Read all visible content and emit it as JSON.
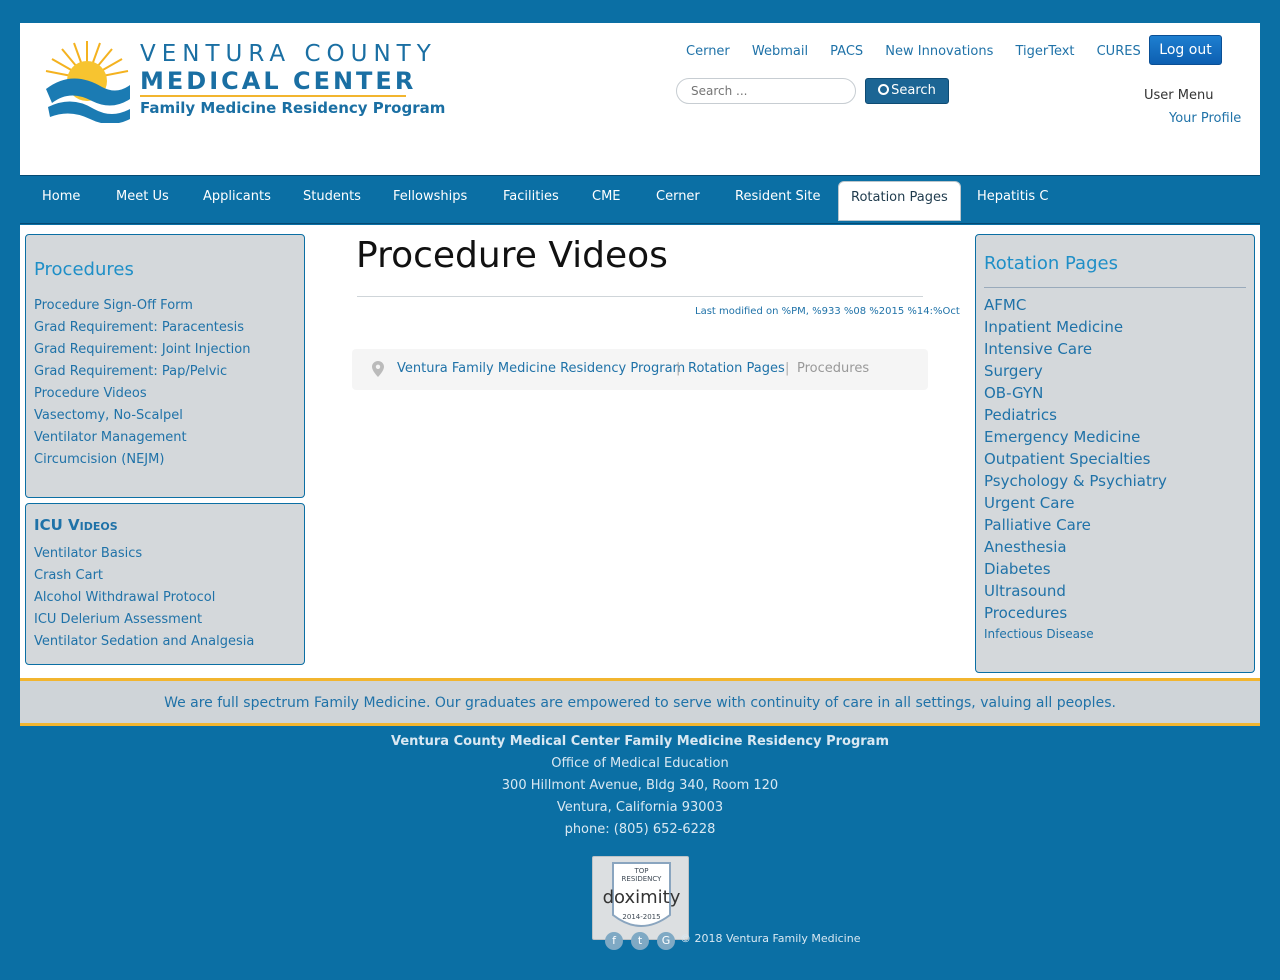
{
  "logo": {
    "line1": "VENTURA COUNTY",
    "line2": "MEDICAL CENTER",
    "line3": "Family Medicine Residency Program"
  },
  "top_links": [
    "Cerner",
    "Webmail",
    "PACS",
    "New Innovations",
    "TigerText",
    "CURES"
  ],
  "logout_label": "Log out",
  "search": {
    "placeholder": "Search ...",
    "button_label": "Search"
  },
  "user_menu": {
    "title": "User Menu",
    "profile_link": "Your Profile"
  },
  "nav": {
    "items": [
      "Home",
      "Meet Us",
      "Applicants",
      "Students",
      "Fellowships",
      "Facilities",
      "CME",
      "Cerner",
      "Resident Site",
      "Rotation Pages",
      "Hepatitis C"
    ],
    "active": "Rotation Pages"
  },
  "left_panel_procedures": {
    "title": "Procedures",
    "links": [
      "Procedure Sign-Off Form",
      "Grad Requirement: Paracentesis",
      "Grad Requirement: Joint Injection",
      "Grad Requirement: Pap/Pelvic",
      "Procedure Videos",
      "Vasectomy, No-Scalpel",
      "Ventilator Management",
      "Circumcision (NEJM)"
    ]
  },
  "left_panel_icu": {
    "title": "ICU Videos",
    "links": [
      "Ventilator Basics",
      "Crash Cart",
      "Alcohol Withdrawal Protocol",
      "ICU Delerium Assessment",
      "Ventilator Sedation and Analgesia"
    ]
  },
  "main": {
    "title": "Procedure Videos",
    "last_modified": "Last modified on %PM, %933 %08 %2015 %14:%Oct",
    "breadcrumb": [
      "Ventura Family Medicine Residency Program",
      "Rotation Pages",
      "Procedures"
    ]
  },
  "right_panel": {
    "title": "Rotation Pages",
    "links": [
      "AFMC",
      "Inpatient Medicine",
      "Intensive Care",
      "Surgery",
      "OB-GYN",
      "Pediatrics",
      "Emergency Medicine",
      "Outpatient Specialties",
      "Psychology & Psychiatry",
      "Urgent Care",
      "Palliative Care",
      "Anesthesia",
      "Diabetes",
      "Ultrasound",
      "Procedures",
      "Infectious Disease"
    ]
  },
  "tagline": "We are full spectrum Family Medicine. Our graduates are empowered to serve with continuity of care in all settings, valuing all peoples.",
  "footer": {
    "org": "Ventura County Medical Center Family Medicine Residency Program",
    "office": "Office of Medical Education",
    "address1": "300 Hillmont Avenue, Bldg 340, Room 120",
    "address2": "Ventura, California 93003",
    "phone": "phone: (805) 652-6228",
    "badge": {
      "top": "TOP",
      "mid": "RESIDENCY",
      "brand": "doximity",
      "years": "2014-2015"
    },
    "copyright": "© 2018 Ventura Family Medicine"
  },
  "colors": {
    "brand_blue": "#0b6fa4",
    "link_blue": "#1f72a8",
    "accent_gold": "#f2b52f",
    "panel_grey": "#d4d8db"
  }
}
